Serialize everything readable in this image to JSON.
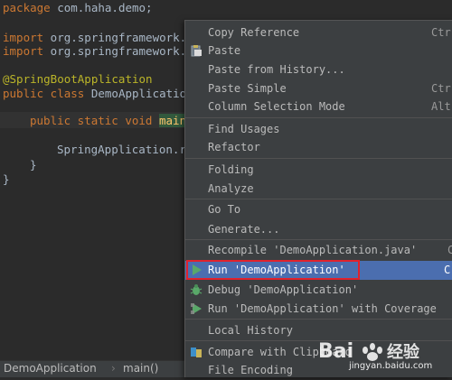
{
  "editor": {
    "lines": {
      "package_kw": "package",
      "package_name": " com.haha.demo;",
      "import1_kw": "import",
      "import1_name": " org.springframework.",
      "import2_kw": "import",
      "import2_name": " org.springframework.",
      "annotation": "@SpringBootApplication",
      "class_kw": "public class",
      "class_name": " DemoApplicatio",
      "main_kw": "public static void",
      "main_name": "main",
      "run_call": "SpringApplication.r",
      "brace_inner": "}",
      "brace_outer": "}"
    }
  },
  "breadcrumb": {
    "class": "DemoApplication",
    "separator": "›",
    "method": "main()"
  },
  "context_menu": {
    "items": {
      "copy_reference": {
        "label": "Copy Reference",
        "shortcut": "Ctr"
      },
      "paste": {
        "label": "Paste",
        "icon": "paste-icon"
      },
      "paste_from_history": {
        "label": "Paste from History..."
      },
      "paste_simple": {
        "label": "Paste Simple",
        "shortcut": "Ctr"
      },
      "column_selection": {
        "label": "Column Selection Mode",
        "shortcut": "Alt"
      },
      "find_usages": {
        "label": "Find Usages"
      },
      "refactor": {
        "label": "Refactor"
      },
      "folding": {
        "label": "Folding"
      },
      "analyze": {
        "label": "Analyze"
      },
      "goto": {
        "label": "Go To"
      },
      "generate": {
        "label": "Generate..."
      },
      "recompile": {
        "label": "Recompile 'DemoApplication.java'",
        "shortcut": "C"
      },
      "run": {
        "label": "Run 'DemoApplication'",
        "shortcut": "C",
        "icon": "run-icon"
      },
      "debug": {
        "label": "Debug 'DemoApplication'",
        "icon": "debug-icon"
      },
      "run_coverage": {
        "label": "Run 'DemoApplication' with Coverage",
        "icon": "coverage-icon"
      },
      "local_history": {
        "label": "Local History"
      },
      "compare_clipboard": {
        "label": "Compare with Clipboard",
        "icon": "compare-icon"
      },
      "file_encoding": {
        "label": "File Encoding"
      }
    }
  },
  "watermark": {
    "brand": "Bai",
    "suffix": "经验",
    "url": "jingyan.baidu.com"
  },
  "colors": {
    "selection": "#4b6eaf",
    "highlight_box": "#e0222d",
    "background": "#2b2b2b",
    "menu_bg": "#3c3f41"
  }
}
